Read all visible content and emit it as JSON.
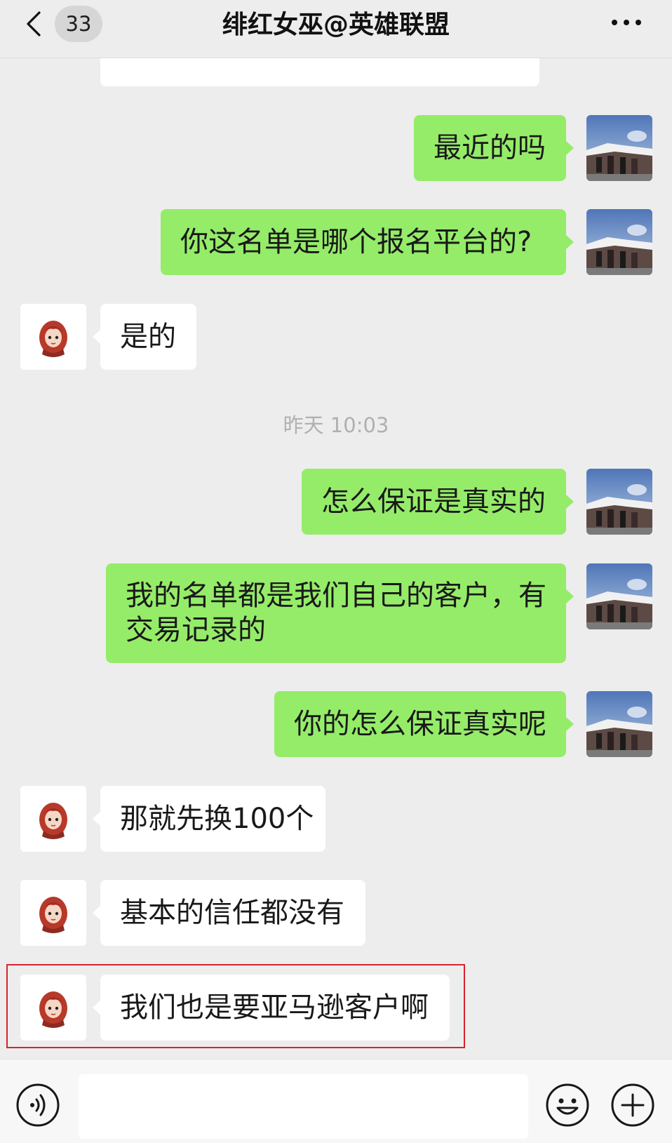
{
  "header": {
    "back_icon": "chevron-left-icon",
    "back_count": "33",
    "title": "绯红女巫@英雄联盟",
    "more_icon": "more-dots-icon"
  },
  "timestamp": "昨天 10:03",
  "messages": [
    {
      "side": "right",
      "text": "最近的吗"
    },
    {
      "side": "right",
      "text": "你这名单是哪个报名平台的?"
    },
    {
      "side": "left",
      "text": "是的"
    },
    {
      "side": "right",
      "text": "怎么保证是真实的"
    },
    {
      "side": "right",
      "text": "我的名单都是我们自己的客户，有交易记录的"
    },
    {
      "side": "right",
      "text": "你的怎么保证真实呢"
    },
    {
      "side": "left",
      "text": "那就先换100个"
    },
    {
      "side": "left",
      "text": "基本的信任都没有"
    },
    {
      "side": "left",
      "text": "我们也是要亚马逊客户啊",
      "highlighted": true
    }
  ],
  "input_bar": {
    "voice_icon": "voice-icon",
    "input_value": "",
    "emoji_icon": "emoji-icon",
    "plus_icon": "plus-icon"
  },
  "colors": {
    "background": "#ededed",
    "outgoing_bubble": "#95ec69",
    "incoming_bubble": "#ffffff",
    "highlight_border": "#d8232d",
    "timestamp_text": "#b0b0b0"
  }
}
